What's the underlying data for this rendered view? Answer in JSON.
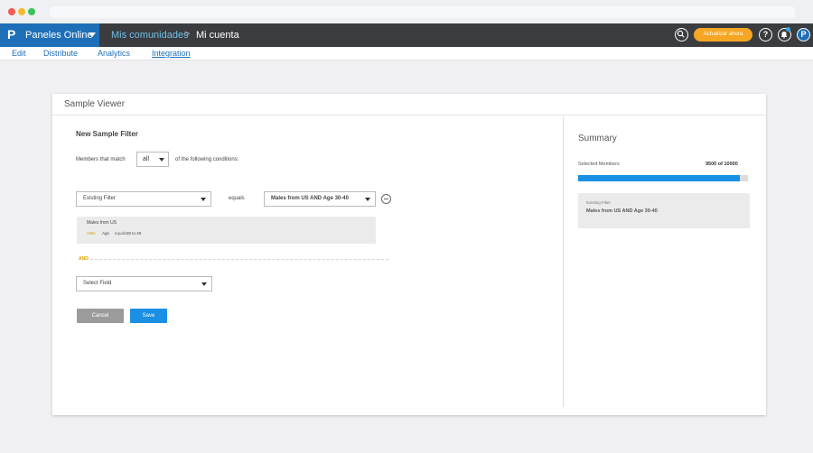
{
  "colors": {
    "brand": "#1e6fb8",
    "accent": "#f5a623",
    "primary": "#1a8fe3",
    "and": "#d6a400"
  },
  "app": {
    "logo": "P",
    "name": "Paneles Online",
    "breadcrumb": [
      "Mis comunidades",
      "Mi cuenta"
    ],
    "breadcrumb_separator": ">",
    "update_label": "Actualizar ahora",
    "help_label": "?",
    "profile_label": "P",
    "icons": [
      "search-icon",
      "help-icon",
      "bell-icon",
      "profile-icon"
    ]
  },
  "subnav": [
    "Edit",
    "Distribute",
    "Analytics",
    "Integration"
  ],
  "panel": {
    "title": "Sample Viewer",
    "filter_title": "New Sample Filter",
    "match_prefix": "Members that match",
    "match_value": "all",
    "match_suffix": "of the following conditions:",
    "row1": {
      "field": "Existing Filter",
      "operator": "equals",
      "value": "Males from US AND Age 30-40"
    },
    "existing_filter": {
      "title": "Males from US",
      "tag": "AND",
      "field": "Age",
      "operator": "equals",
      "value": "30 to 40"
    },
    "and_label": "AND",
    "row2": {
      "field": "Select Field"
    },
    "cancel_label": "Cancel",
    "save_label": "Save"
  },
  "summary": {
    "title": "Summary",
    "selected_label": "Selected Members",
    "selected_count": "9500 of 10000",
    "progress": 0.95,
    "filter_label": "Existing Filter",
    "filter_value": "Males from US AND Age 30-40"
  }
}
